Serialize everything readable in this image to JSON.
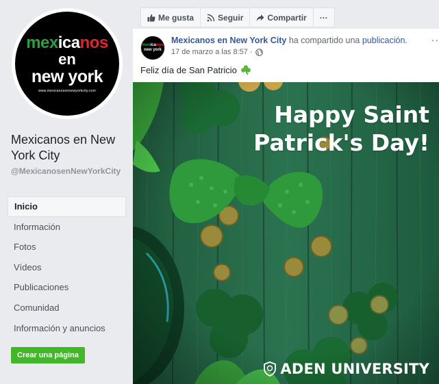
{
  "sidebar": {
    "logo": {
      "line1_a": "mex",
      "line1_b": "ica",
      "line1_c": "nos",
      "line2": "en",
      "line3": "new york",
      "url": "www.mexicanosennewyorkcity.com"
    },
    "page_name": "Mexicanos en New York City",
    "page_handle": "@MexicanosenNewYorkCity",
    "nav": [
      {
        "label": "Inicio",
        "active": true
      },
      {
        "label": "Información"
      },
      {
        "label": "Fotos"
      },
      {
        "label": "Vídeos"
      },
      {
        "label": "Publicaciones"
      },
      {
        "label": "Comunidad"
      },
      {
        "label": "Información y anuncios"
      }
    ],
    "create_page_label": "Crear una página"
  },
  "actions": {
    "like": "Me gusta",
    "follow": "Seguir",
    "share": "Compartir",
    "more": "···"
  },
  "post": {
    "author": "Mexicanos en New York City",
    "shared_text": " ha compartido una ",
    "shared_link": "publicación",
    "shared_end": ".",
    "timestamp": "17 de marzo a las 8:57 ·",
    "text": "Feliz día de San Patricio",
    "avatar": {
      "line1_a": "mex",
      "line1_b": "ica",
      "line1_c": "nos",
      "line2": "new york"
    },
    "image": {
      "headline_line1": "Happy Saint",
      "headline_line2": "Patrick's Day!",
      "brand": "ADEN UNIVERSITY"
    }
  },
  "colors": {
    "link": "#365899",
    "green_button": "#42b72a",
    "background": "#e9ebee"
  },
  "icons": [
    "thumbs-up-icon",
    "rss-icon",
    "share-arrow-icon",
    "globe-icon",
    "shamrock-icon",
    "shield-icon"
  ]
}
